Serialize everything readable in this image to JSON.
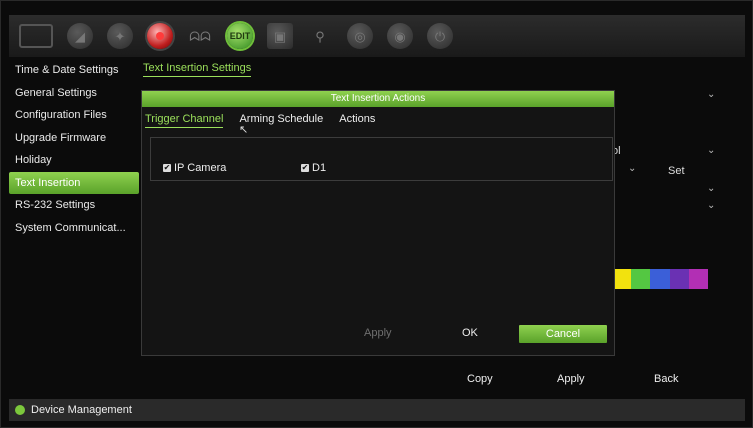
{
  "toolbar": {
    "icons": [
      "monitor-icon",
      "camera-icon",
      "network-icon",
      "live-record-icon",
      "people-icon",
      "device-management-icon",
      "hdd-icon",
      "alarm-icon",
      "audio-icon",
      "settings-icon",
      "power-icon"
    ],
    "active_label": "EDIT"
  },
  "sidebar": {
    "items": [
      {
        "label": "Time & Date Settings"
      },
      {
        "label": "General Settings"
      },
      {
        "label": "Configuration Files"
      },
      {
        "label": "Upgrade Firmware"
      },
      {
        "label": "Holiday"
      },
      {
        "label": "Text Insertion"
      },
      {
        "label": "RS-232 Settings"
      },
      {
        "label": "System Communicat..."
      }
    ],
    "selected_index": 5
  },
  "main": {
    "tab_label": "Text Insertion Settings",
    "partial_text": "ol",
    "set_label": "Set",
    "footer": {
      "copy": "Copy",
      "apply": "Apply",
      "back": "Back"
    },
    "color_swatches": [
      "#f2e20e",
      "#54c742",
      "#3b5fd8",
      "#6a31b3",
      "#b22fb4"
    ]
  },
  "modal": {
    "title": "Text Insertion Actions",
    "tabs": [
      {
        "label": "Trigger Channel"
      },
      {
        "label": "Arming Schedule"
      },
      {
        "label": "Actions"
      }
    ],
    "active_tab": 0,
    "channels": [
      {
        "label": "IP Camera",
        "checked": true
      },
      {
        "label": "D1",
        "checked": true
      }
    ],
    "buttons": {
      "apply": "Apply",
      "ok": "OK",
      "cancel": "Cancel"
    }
  },
  "status": {
    "label": "Device Management"
  }
}
